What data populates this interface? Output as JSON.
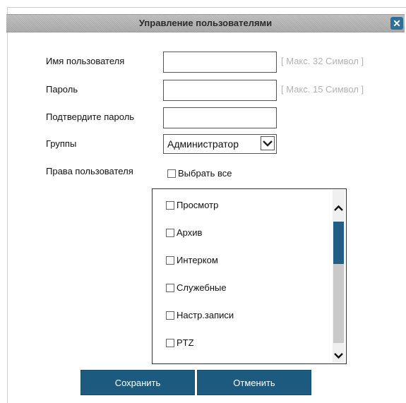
{
  "dialog": {
    "title": "Управление пользователями",
    "close_symbol": "✕"
  },
  "form": {
    "username": {
      "label": "Имя пользователя",
      "value": "",
      "hint": "[ Макс. 32 Символ ]"
    },
    "password": {
      "label": "Пароль",
      "value": "",
      "hint": "[ Макс. 15 Символ ]"
    },
    "confirm_password": {
      "label": "Подтвердите пароль",
      "value": ""
    },
    "group": {
      "label": "Группы",
      "selected": "Администратор",
      "options": [
        "Администратор"
      ]
    },
    "rights": {
      "label": "Права пользователя",
      "select_all_label": "Выбрать все",
      "select_all_checked": false,
      "items": [
        {
          "label": "Просмотр",
          "checked": false
        },
        {
          "label": "Архив",
          "checked": false
        },
        {
          "label": "Интерком",
          "checked": false
        },
        {
          "label": "Служебные",
          "checked": false
        },
        {
          "label": "Настр.записи",
          "checked": false
        },
        {
          "label": "PTZ",
          "checked": false
        }
      ],
      "scroll_position": 0
    }
  },
  "buttons": {
    "save_label": "Сохранить",
    "cancel_label": "Отменить"
  },
  "icons": {
    "close": "close-icon",
    "select_arrow": "chevron-down-icon",
    "scroll_up": "chevron-up-icon",
    "scroll_down": "chevron-down-icon"
  },
  "colors": {
    "title_bar": "#b2b2b2",
    "accent": "#1d5a80",
    "hint_text": "#b3b3b3"
  }
}
